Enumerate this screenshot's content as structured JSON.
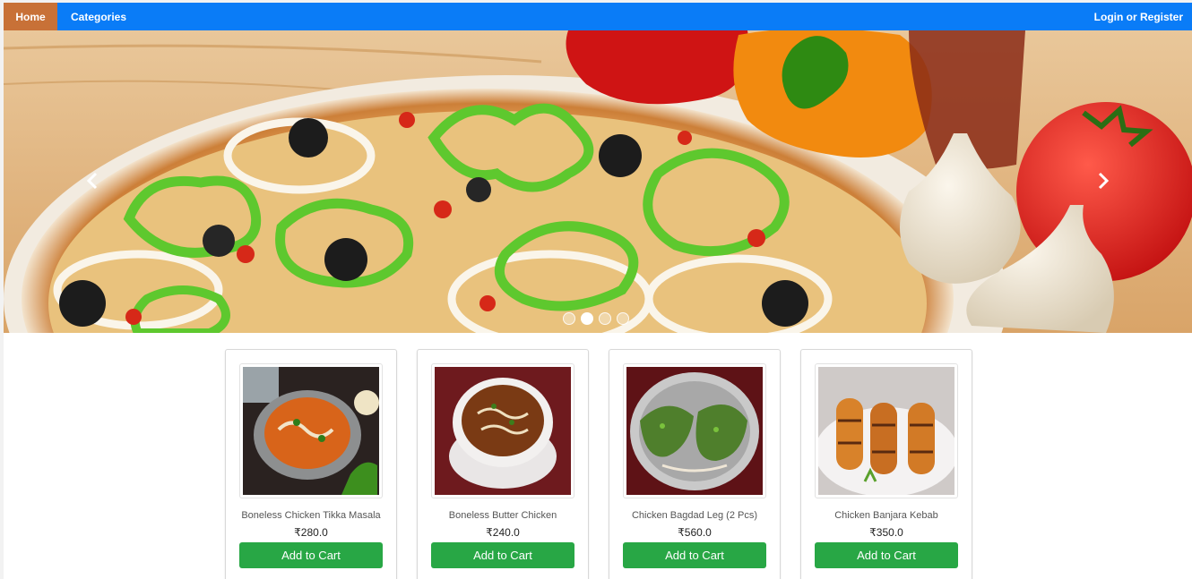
{
  "navbar": {
    "home_label": "Home",
    "categories_label": "Categories",
    "login_label": "Login or Register",
    "color": "#0a7cf7",
    "active_color": "#c87137"
  },
  "carousel": {
    "image": "pizza-with-peppers-tomato-garlic",
    "slide_count": 4,
    "active_slide": 2
  },
  "products": [
    {
      "name": "Boneless Chicken Tikka Masala",
      "price": "₹280.0",
      "button": "Add to Cart",
      "image": "chicken-tikka-masala-bowl"
    },
    {
      "name": "Boneless Butter Chicken",
      "price": "₹240.0",
      "button": "Add to Cart",
      "image": "butter-chicken-bowl"
    },
    {
      "name": "Chicken Bagdad Leg (2 Pcs)",
      "price": "₹560.0",
      "button": "Add to Cart",
      "image": "chicken-legs-platter"
    },
    {
      "name": "Chicken Banjara Kebab",
      "price": "₹350.0",
      "button": "Add to Cart",
      "image": "chicken-kebab-plate"
    }
  ],
  "colors": {
    "button": "#28a745"
  }
}
